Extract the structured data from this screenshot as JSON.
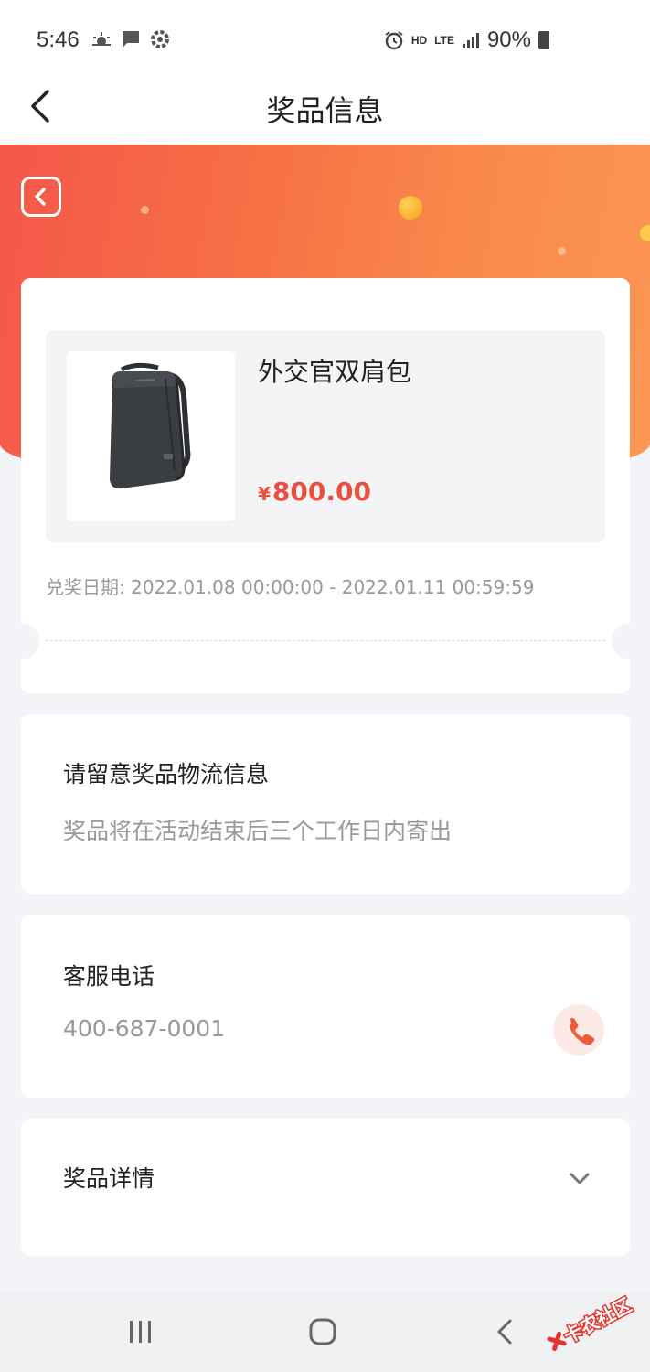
{
  "status_bar": {
    "time": "5:46",
    "signal_labels": {
      "hd": "HD",
      "lte": "LTE"
    },
    "battery": "90%",
    "icons": [
      "weather-sunrise-icon",
      "message-icon",
      "settings-icon",
      "alarm-icon",
      "signal-icon",
      "battery-icon"
    ]
  },
  "header": {
    "title": "奖品信息",
    "back_icon": "chevron-left-icon"
  },
  "banner": {
    "back_icon": "back-square-icon"
  },
  "prize": {
    "name": "外交官双肩包",
    "currency": "¥",
    "amount": "800.00",
    "image_icon": "backpack-image",
    "redeem_date": "兑奖日期: 2022.01.08 00:00:00 - 2022.01.11 00:59:59"
  },
  "logistics": {
    "title": "请留意奖品物流信息",
    "note": "奖品将在活动结束后三个工作日内寄出"
  },
  "service": {
    "title": "客服电话",
    "phone": "400-687-0001",
    "icon": "phone-icon"
  },
  "details": {
    "title": "奖品详情",
    "icon": "chevron-down-icon"
  },
  "nav_bar": {
    "icons": [
      "recents-icon",
      "home-icon",
      "back-icon"
    ]
  },
  "watermark": {
    "text": "卡农社区"
  },
  "colors": {
    "accent": "#e9503f",
    "banner_start": "#f4574a",
    "banner_end": "#fb9754",
    "background": "#f3f4f8"
  }
}
